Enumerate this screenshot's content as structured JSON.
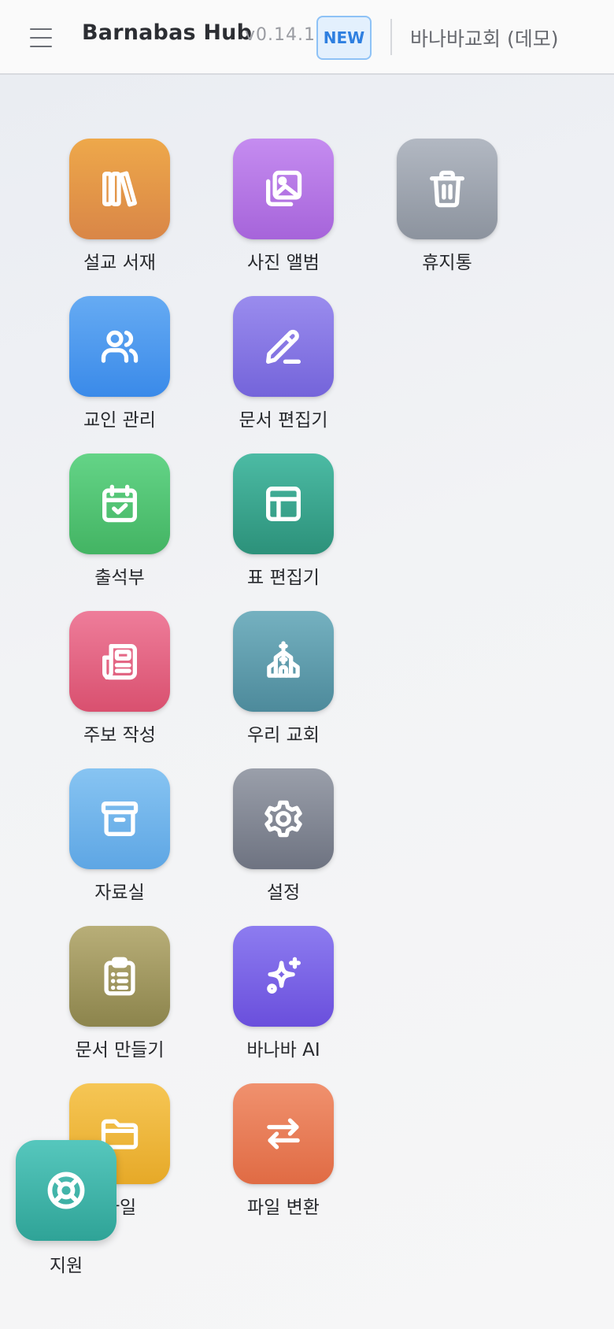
{
  "header": {
    "app_name": "Barnabas Hub",
    "version": "v0.14.1",
    "new_badge": "NEW",
    "church_name": "바나바교회 (데모)"
  },
  "apps": [
    {
      "label": "설교 서재",
      "icon": "books-icon",
      "color": "#e8964a"
    },
    {
      "label": "사진 앨범",
      "icon": "photos-icon",
      "color": "#b57de3"
    },
    {
      "label": "휴지통",
      "icon": "trash-icon",
      "color": "#98a0ab"
    },
    {
      "label": "교인 관리",
      "icon": "users-icon",
      "color": "#4b97ee"
    },
    {
      "label": "문서 편집기",
      "icon": "pen-icon",
      "color": "#8677e2"
    },
    {
      "label": "출석부",
      "icon": "calendar-check-icon",
      "color": "#55c575"
    },
    {
      "label": "표 편집기",
      "icon": "table-icon",
      "color": "#38a58c"
    },
    {
      "label": "주보 작성",
      "icon": "newspaper-icon",
      "color": "#e36585"
    },
    {
      "label": "우리 교회",
      "icon": "church-icon",
      "color": "#5e9dad"
    },
    {
      "label": "자료실",
      "icon": "archive-icon",
      "color": "#76b4ea"
    },
    {
      "label": "설정",
      "icon": "gear-icon",
      "color": "#7f8593"
    },
    {
      "label": "문서 만들기",
      "icon": "clipboard-icon",
      "color": "#a39a5e"
    },
    {
      "label": "바나바 AI",
      "icon": "sparkles-icon",
      "color": "#7b62e4"
    },
    {
      "label": "파일",
      "icon": "folder-icon",
      "color": "#f0bb34"
    },
    {
      "label": "파일 변환",
      "icon": "arrows-swap-icon",
      "color": "#e87b59"
    }
  ],
  "support": {
    "label": "지원",
    "icon": "lifebuoy-icon",
    "color": "#3db3a7"
  }
}
